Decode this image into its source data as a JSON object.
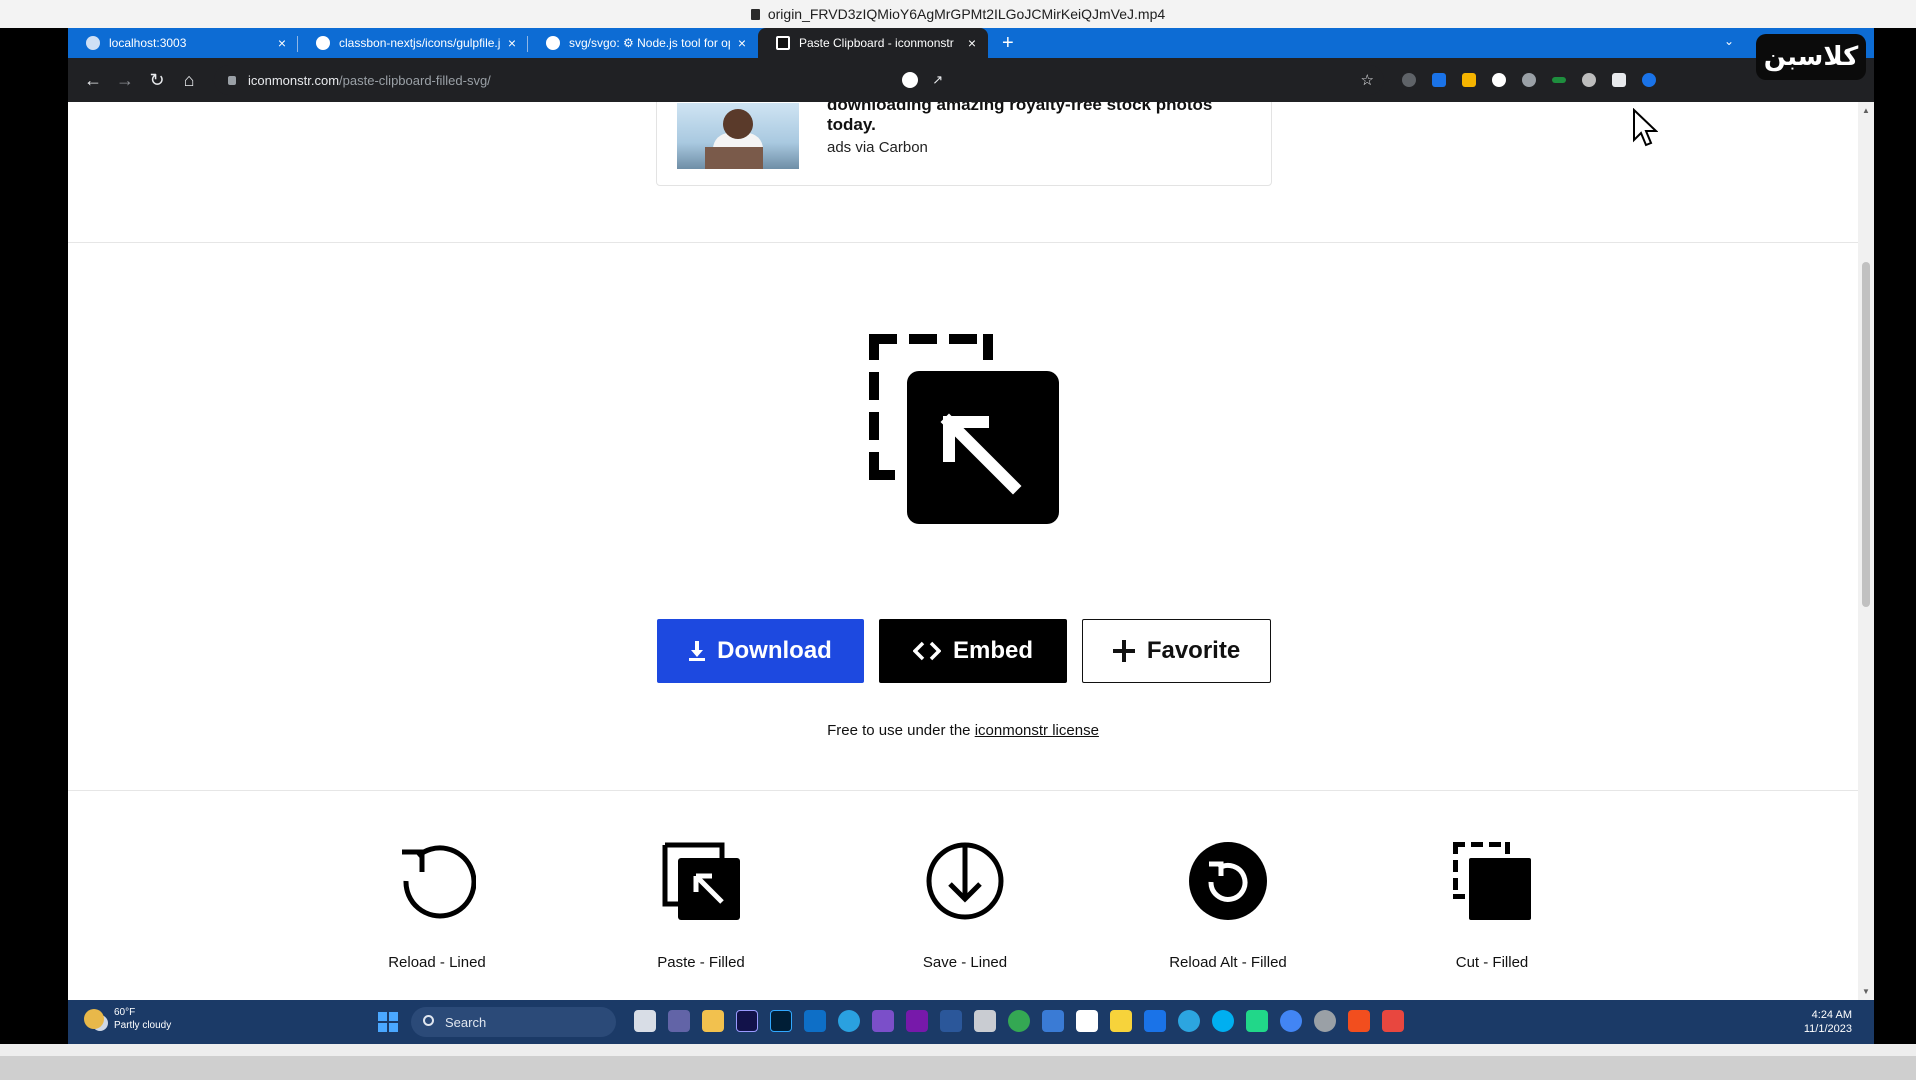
{
  "player": {
    "title": "origin_FRVD3zIQMioY6AgMrGPMt2ILGoJCMirKeiQJmVeJ.mp4"
  },
  "browser": {
    "tabs": [
      {
        "label": "localhost:3003",
        "icon": "globe-icon"
      },
      {
        "label": "classbon-nextjs/icons/gulpfile.js",
        "icon": "github-icon"
      },
      {
        "label": "svg/svgo: ⚙ Node.js tool for op",
        "icon": "github-icon"
      },
      {
        "label": "Paste Clipboard - iconmonstr",
        "icon": "iconmonstr-icon",
        "active": true
      }
    ],
    "close_glyph": "×",
    "new_tab_glyph": "+",
    "url_host": "iconmonstr.com",
    "url_path": "/paste-clipboard-filled-svg/",
    "overlay_logo_text": "کلاسبن"
  },
  "ad": {
    "headline": "downloading amazing royalty-free stock photos today.",
    "via": "ads via Carbon"
  },
  "actions": {
    "download": "Download",
    "embed": "Embed",
    "favorite": "Favorite"
  },
  "license": {
    "prefix": "Free to use under the",
    "link": "iconmonstr license"
  },
  "related": [
    {
      "label": "Reload - Lined",
      "icon": "reload-lined-icon"
    },
    {
      "label": "Paste - Filled",
      "icon": "paste-filled-icon"
    },
    {
      "label": "Save - Lined",
      "icon": "save-lined-icon"
    },
    {
      "label": "Reload Alt - Filled",
      "icon": "reload-alt-filled-icon"
    },
    {
      "label": "Cut - Filled",
      "icon": "cut-filled-icon"
    }
  ],
  "taskbar": {
    "temp": "60°F",
    "weather": "Partly cloudy",
    "search_placeholder": "Search",
    "time": "4:24 AM",
    "date": "11/1/2023"
  },
  "colors": {
    "accent_blue": "#1d49e0",
    "tab_bar": "#0d6cd4",
    "taskbar": "#1b3a67"
  }
}
